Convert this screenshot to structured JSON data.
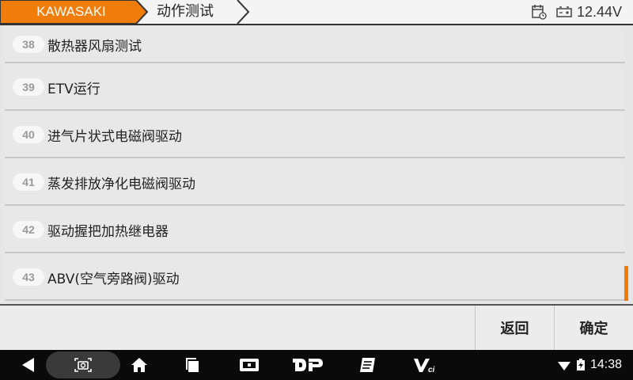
{
  "header": {
    "brand": "KAWASAKI",
    "page_title": "动作测试",
    "voltage": "12.44V",
    "brand_color": "#f07d0a"
  },
  "list": {
    "items": [
      {
        "num": "38",
        "label": "散热器风扇测试"
      },
      {
        "num": "39",
        "label": "ETV运行"
      },
      {
        "num": "40",
        "label": "进气片状式电磁阀驱动"
      },
      {
        "num": "41",
        "label": "蒸发排放净化电磁阀驱动"
      },
      {
        "num": "42",
        "label": "驱动握把加热继电器"
      },
      {
        "num": "43",
        "label": "ABV(空气旁路阀)驱动"
      }
    ]
  },
  "actions": {
    "back_label": "返回",
    "ok_label": "确定"
  },
  "navbar": {
    "time": "14:38",
    "icons": [
      "back-icon",
      "screenshot-icon",
      "home-icon",
      "recents-icon",
      "diag-app-icon",
      "dp-icon",
      "report-icon",
      "vci-icon",
      "wifi-icon",
      "battery-icon"
    ],
    "dp_text": "DP",
    "vci_text": "Vci"
  }
}
